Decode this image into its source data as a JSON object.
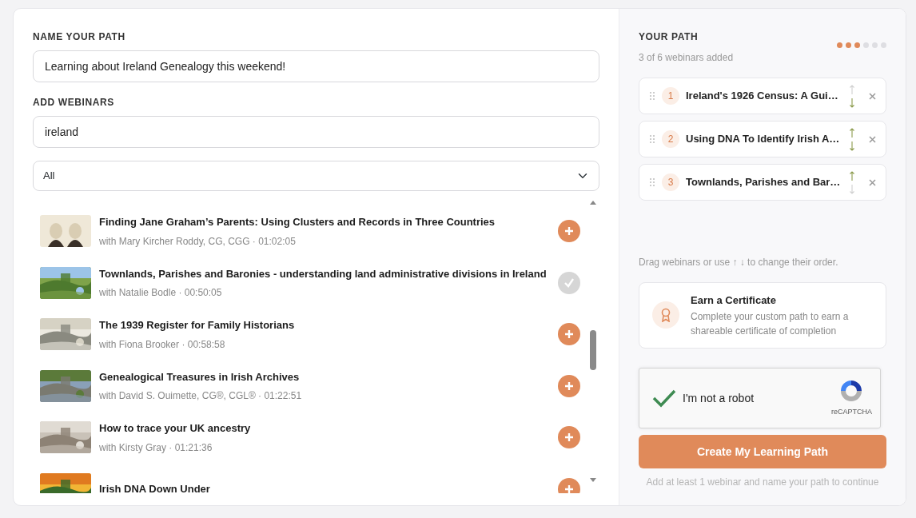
{
  "builder": {
    "name_label": "NAME YOUR PATH",
    "name_value": "Learning about Ireland Genealogy this weekend!",
    "add_label": "ADD WEBINARS",
    "search_value": "ireland",
    "filter_value": "All",
    "webinars": [
      {
        "title": "Finding Jane Graham’s Parents: Using Clusters and Records in Three Countries",
        "meta": "with Mary Kircher Roddy, CG, CGG · 01:02:05",
        "added": false
      },
      {
        "title": "Townlands, Parishes and Baronies - understanding land administrative divisions in Ireland",
        "meta": "with Natalie Bodle · 00:50:05",
        "added": true
      },
      {
        "title": "The 1939 Register for Family Historians",
        "meta": "with Fiona Brooker · 00:58:58",
        "added": false
      },
      {
        "title": "Genealogical Treasures in Irish Archives",
        "meta": "with David S. Ouimette, CG®, CGL® · 01:22:51",
        "added": false
      },
      {
        "title": "How to trace your UK ancestry",
        "meta": "with Kirsty Gray · 01:21:36",
        "added": false
      },
      {
        "title": "Irish DNA Down Under",
        "added": false
      }
    ]
  },
  "path": {
    "heading": "YOUR PATH",
    "count": "3 of 6 webinars added",
    "progress_dots": [
      {
        "filled": true
      },
      {
        "filled": true
      },
      {
        "filled": true
      },
      {
        "filled": false
      },
      {
        "filled": false
      },
      {
        "filled": false
      }
    ],
    "items": [
      {
        "number": "1",
        "title": "Ireland's 1926 Census: A Gui…",
        "up_disabled": true,
        "down_disabled": false
      },
      {
        "number": "2",
        "title": "Using DNA To Identify Irish A…",
        "up_disabled": false,
        "down_disabled": false
      },
      {
        "number": "3",
        "title": "Townlands, Parishes and Bar…",
        "up_disabled": false,
        "down_disabled": true
      }
    ],
    "hint": "Drag webinars or use ↑ ↓ to change their order.",
    "certificate": {
      "title": "Earn a Certificate",
      "text": "Complete your custom path to earn a shareable certificate of completion"
    },
    "captcha": {
      "label": "I'm not a robot",
      "brand": "reCAPTCHA",
      "checked": true
    },
    "create_button": "Create My Learning Path",
    "footnote": "Add at least 1 webinar and name your path to continue"
  }
}
